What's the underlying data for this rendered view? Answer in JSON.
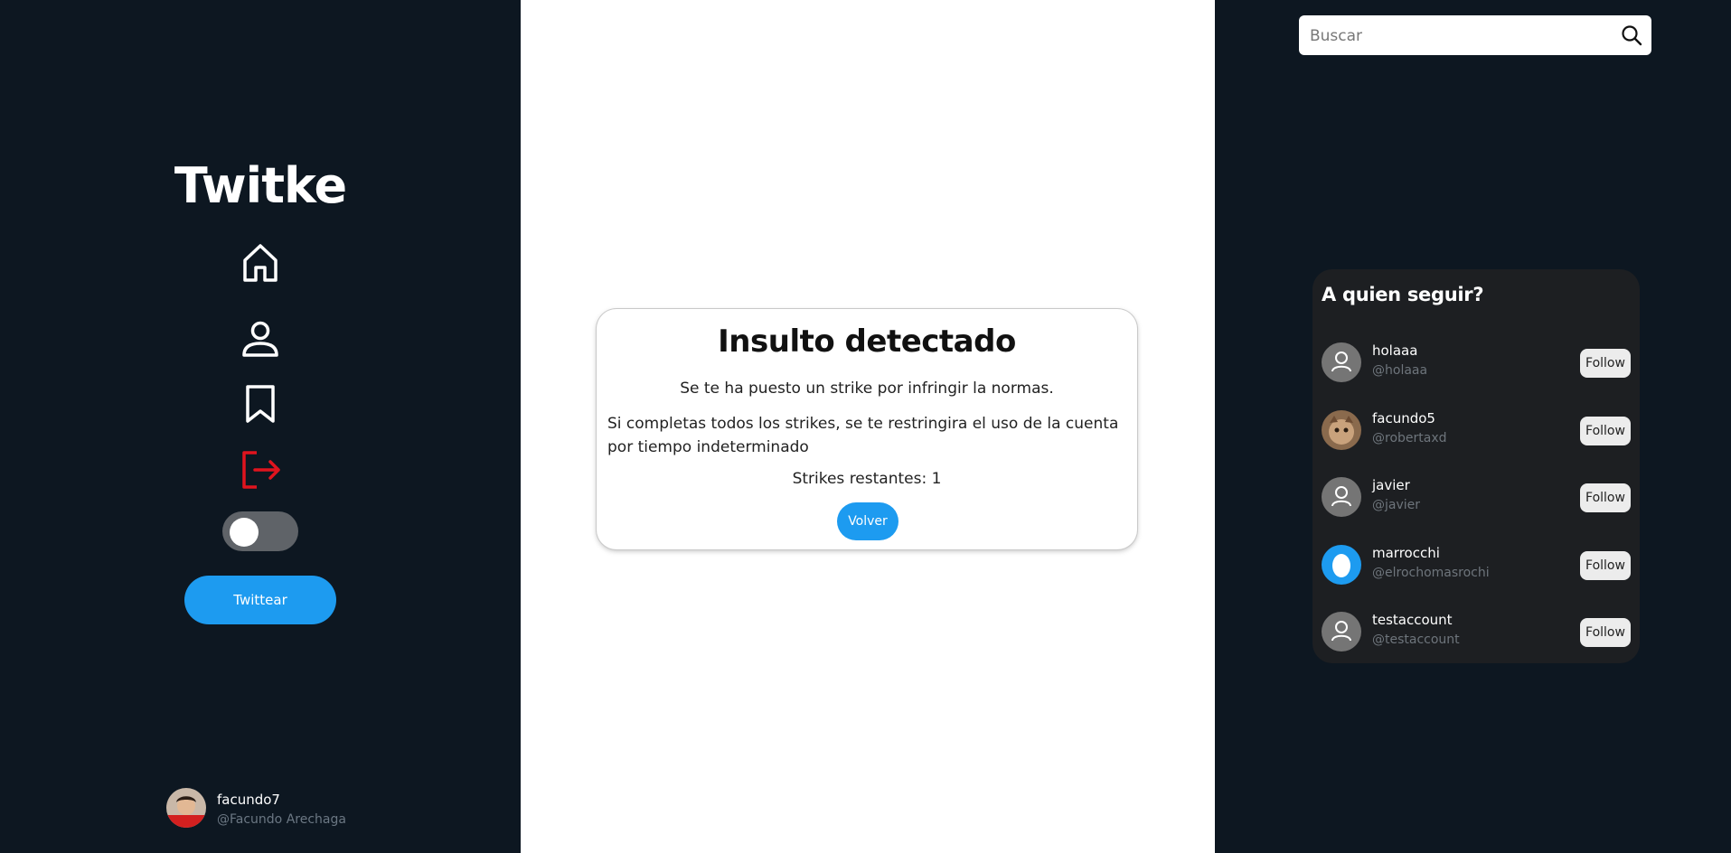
{
  "sidebar": {
    "brand": "Twitke",
    "nav": [
      {
        "icon": "home-icon"
      },
      {
        "icon": "profile-icon"
      },
      {
        "icon": "bookmark-icon"
      },
      {
        "icon": "logout-icon",
        "color": "#e0141e"
      }
    ],
    "theme_toggle": {
      "on": false
    },
    "tweet_button": "Twittear",
    "current_user": {
      "name": "facundo7",
      "handle": "@Facundo Arechaga"
    }
  },
  "modal": {
    "title": "Insulto detectado",
    "line1": "Se te ha puesto un strike por infringir la normas.",
    "line2": "Si completas todos los strikes, se te restringira el uso de la cuenta por tiempo indeterminado",
    "strikes": "Strikes restantes: 1",
    "button": "Volver"
  },
  "search": {
    "placeholder": "Buscar",
    "value": ""
  },
  "who_to_follow": {
    "title": "A quien seguir?",
    "users": [
      {
        "name": "holaaa",
        "handle": "@holaaa",
        "button": "Follow",
        "avatar": "default-avatar-icon"
      },
      {
        "name": "facundo5",
        "handle": "@robertaxd",
        "button": "Follow",
        "avatar": "cat-photo-avatar"
      },
      {
        "name": "javier",
        "handle": "@javier",
        "button": "Follow",
        "avatar": "default-avatar-icon"
      },
      {
        "name": "marrocchi",
        "handle": "@elrochomasrochi",
        "button": "Follow",
        "avatar": "egg-avatar"
      },
      {
        "name": "testaccount",
        "handle": "@testaccount",
        "button": "Follow",
        "avatar": "default-avatar-icon"
      }
    ]
  },
  "colors": {
    "background": "#0d1721",
    "accent": "#1d9bf0",
    "logout": "#e0141e",
    "panel": "#1d1f22"
  }
}
